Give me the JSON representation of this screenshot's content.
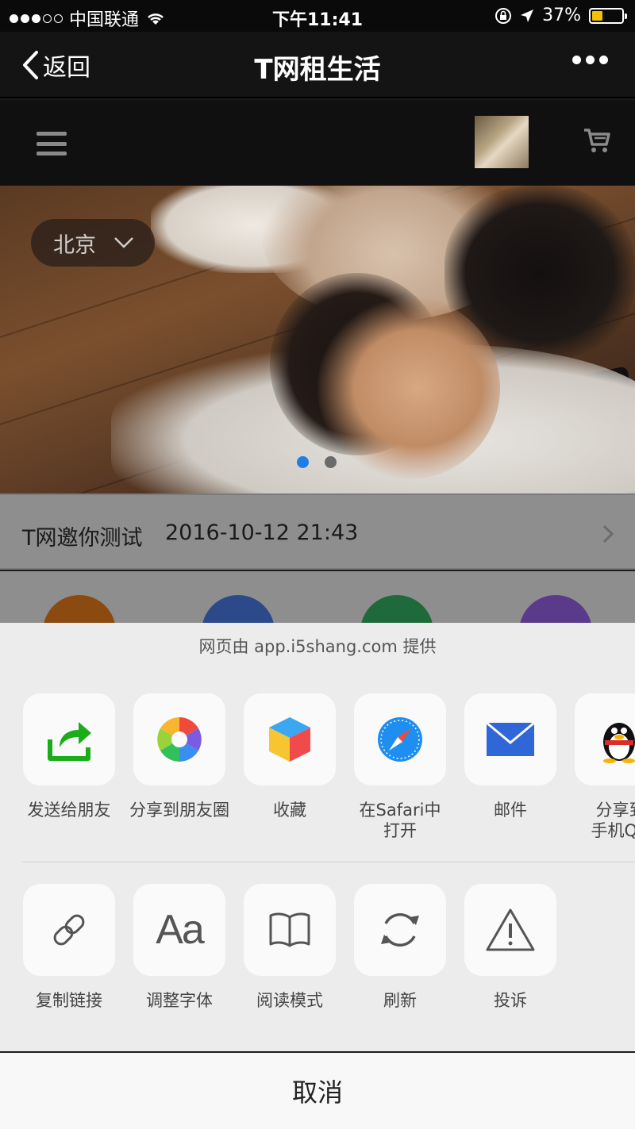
{
  "status_bar": {
    "carrier": "中国联通",
    "time": "下午11:41",
    "battery_percent": "37%",
    "battery_level": 0.37
  },
  "nav": {
    "back_label": "返回",
    "title": "T网租生活"
  },
  "banner": {
    "city": "北京",
    "slides_total": 2,
    "active_slide": 1
  },
  "notice": {
    "title": "T网邀你测试",
    "time": "2016-10-12 21:43"
  },
  "share_sheet": {
    "source_text": "网页由 app.i5shang.com 提供",
    "share_row": [
      {
        "label": "发送给朋友",
        "icon": "send-to-friend-icon"
      },
      {
        "label": "分享到朋友圈",
        "icon": "moments-icon"
      },
      {
        "label": "收藏",
        "icon": "favorites-cube-icon"
      },
      {
        "label": "在Safari中\n打开",
        "icon": "safari-compass-icon"
      },
      {
        "label": "邮件",
        "icon": "mail-icon"
      },
      {
        "label": "分享到\n手机QQ",
        "icon": "qq-penguin-icon"
      }
    ],
    "action_row": [
      {
        "label": "复制链接",
        "icon": "link-icon"
      },
      {
        "label": "调整字体",
        "icon": "font-icon",
        "glyph": "Aa"
      },
      {
        "label": "阅读模式",
        "icon": "book-icon"
      },
      {
        "label": "刷新",
        "icon": "refresh-icon"
      },
      {
        "label": "投诉",
        "icon": "warning-icon"
      }
    ],
    "cancel_label": "取消"
  },
  "colors": {
    "accent_blue": "#1e7ee6",
    "battery_yellow": "#f2c200",
    "wechat_green": "#1aad19"
  }
}
